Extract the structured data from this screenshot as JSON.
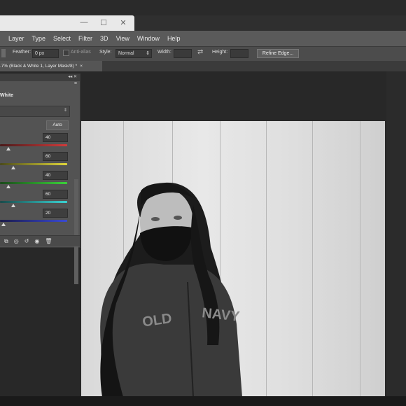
{
  "menubar": [
    "Layer",
    "Type",
    "Select",
    "Filter",
    "3D",
    "View",
    "Window",
    "Help"
  ],
  "options": {
    "feather_label": "Feather:",
    "feather_value": "0 px",
    "antialias_label": "Anti-alias",
    "style_label": "Style:",
    "style_value": "Normal",
    "width_label": "Width:",
    "height_label": "Height:",
    "refine_edge": "Refine Edge..."
  },
  "document_tab": {
    "label": ".7% (Black & White 1, Layer Mask/8) *",
    "close": "×"
  },
  "panel": {
    "title": "White",
    "auto_button": "Auto",
    "sliders": [
      {
        "value": "40",
        "color": "red",
        "knob": 0.13
      },
      {
        "value": "60",
        "color": "yellow",
        "knob": 0.2
      },
      {
        "value": "40",
        "color": "green",
        "knob": 0.13
      },
      {
        "value": "60",
        "color": "cyan",
        "knob": 0.2
      },
      {
        "value": "20",
        "color": "blue",
        "knob": 0.05
      }
    ]
  },
  "window_controls": [
    "—",
    "☐",
    "✕"
  ]
}
